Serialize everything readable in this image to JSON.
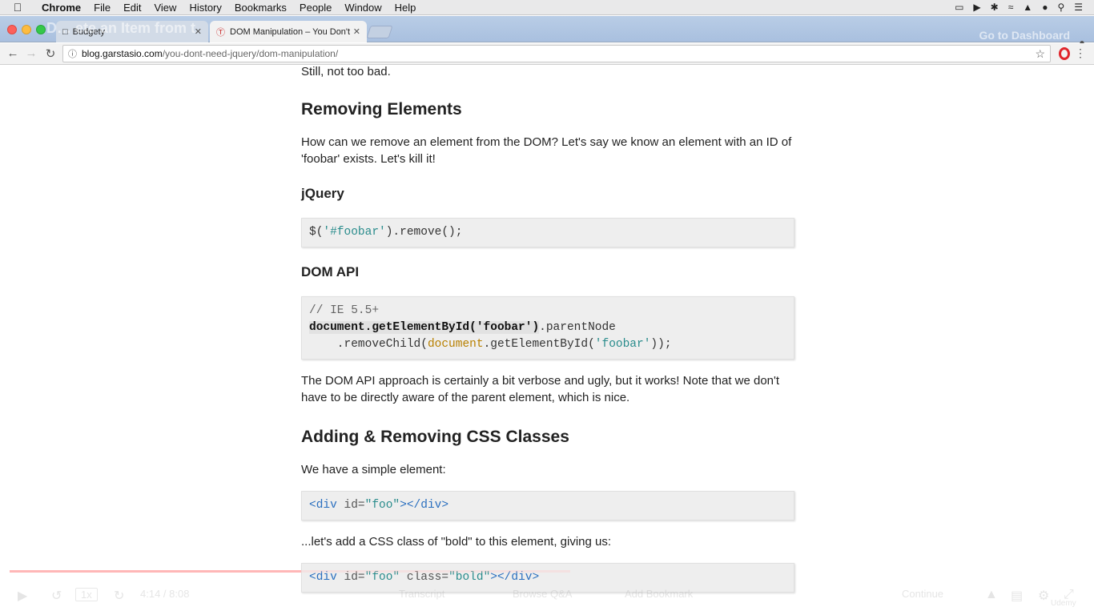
{
  "menubar": {
    "app": "Chrome",
    "items": [
      "File",
      "Edit",
      "View",
      "History",
      "Bookmarks",
      "People",
      "Window",
      "Help"
    ],
    "status_icons": [
      "display-icon",
      "video-icon",
      "bluetooth-icon",
      "wifi-icon",
      "volume-icon",
      "user-icon",
      "search-icon",
      "list-icon"
    ]
  },
  "tabs": {
    "tab1": "Budgety",
    "tab2": "DOM Manipulation – You Don't",
    "ghost_left": "D… ete an Item from t",
    "ghost_right": "Go to Dashboard"
  },
  "address": {
    "host": "blog.garstasio.com",
    "path": "/you-dont-need-jquery/dom-manipulation/"
  },
  "article": {
    "intro": "Still, not too bad.",
    "h_removing": "Removing Elements",
    "p_removing": "How can we remove an element from the DOM? Let's say we know an element with an ID of 'foobar' exists. Let's kill it!",
    "h_jquery": "jQuery",
    "code_jquery": {
      "pre": "$(",
      "str": "'#foobar'",
      "post": ").remove();"
    },
    "h_domapi": "DOM API",
    "code_dom": {
      "comment": "// IE 5.5+",
      "line2_bold": "document.getElementById('foobar')",
      "line2_rest": ".parentNode",
      "line3_indent": "    .removeChild(",
      "line3_kw": "document",
      "line3_mid": ".getElementById(",
      "line3_str": "'foobar'",
      "line3_end": "));"
    },
    "p_verbose": "The DOM API approach is certainly a bit verbose and ugly, but it works! Note that we don't have to be directly aware of the parent element, which is nice.",
    "h_classes": "Adding & Removing CSS Classes",
    "p_simple": "We have a simple element:",
    "code_div1": {
      "open": "<div ",
      "attr": "id=",
      "val": "\"foo\"",
      "close": "></div>"
    },
    "p_bold": "...let's add a CSS class of \"bold\" to this element, giving us:",
    "code_div2": {
      "open": "<div ",
      "attr1": "id=",
      "val1": "\"foo\"",
      "attr2": " class=",
      "val2": "\"bold\"",
      "close": "></div>"
    }
  },
  "video": {
    "progress": 0.52,
    "speed": "1x",
    "time": "4:14 / 8:08",
    "transcript": "Transcript",
    "qa": "Browse Q&A",
    "bookmark": "Add Bookmark",
    "continue": "Continue",
    "brand": "Udemy"
  },
  "colors": {
    "tabstrip": "#b0c6e3",
    "code_bg": "#eeeeee",
    "string": "#2a8c8c",
    "tag": "#2a6fbf",
    "keyword": "#b88000"
  }
}
